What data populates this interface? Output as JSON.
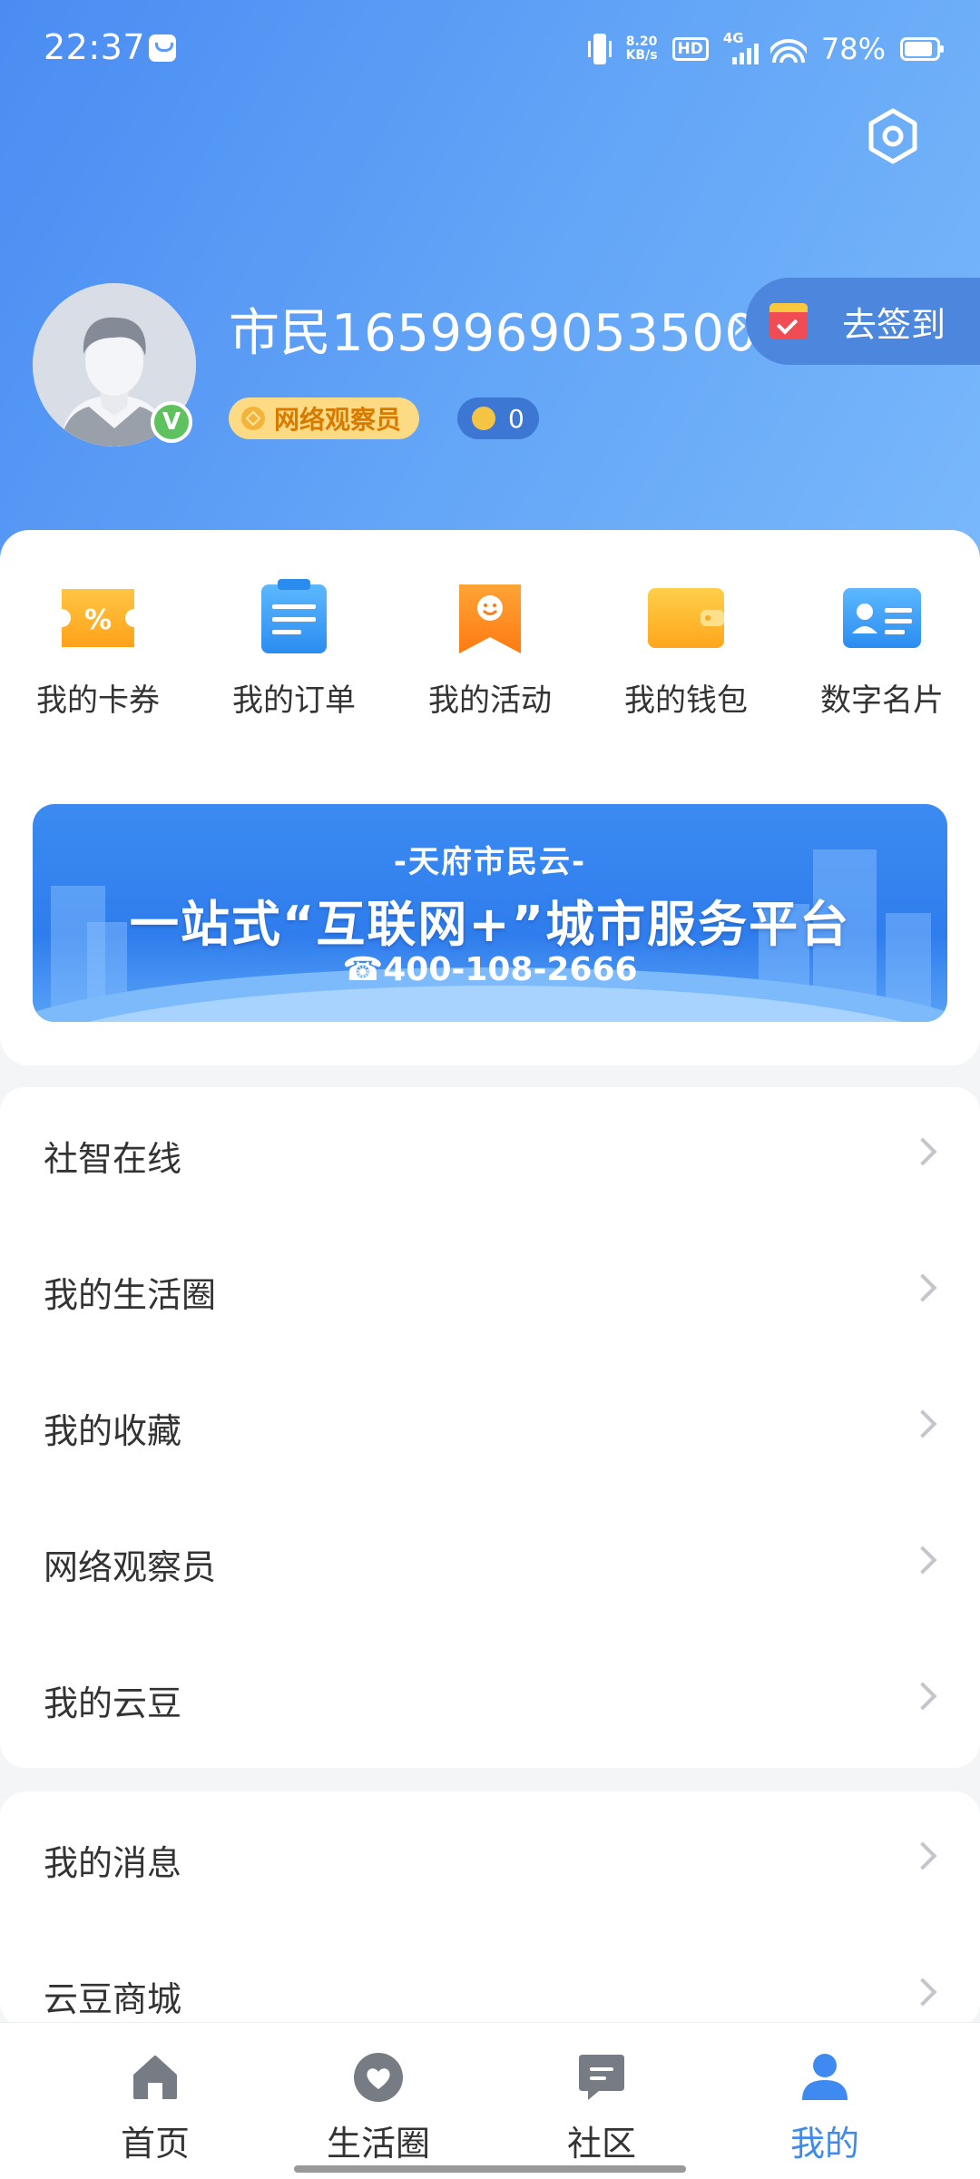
{
  "status_bar": {
    "time": "22:37",
    "net_speed_value": "8.20",
    "net_speed_unit": "KB/s",
    "hd": "HD",
    "network": "4G",
    "battery": "78%"
  },
  "profile": {
    "username": "市民1659969053500",
    "role_badge": "网络观察员",
    "beans_count": "0",
    "verified_mark": "V",
    "signin_label": "去签到"
  },
  "quick_actions": [
    {
      "label": "我的卡券",
      "icon": "coupon-icon",
      "color": "#ffb62d"
    },
    {
      "label": "我的订单",
      "icon": "order-icon",
      "color": "#3a9af2"
    },
    {
      "label": "我的活动",
      "icon": "activity-icon",
      "color": "#ff8a1f"
    },
    {
      "label": "我的钱包",
      "icon": "wallet-icon",
      "color": "#ffb62d"
    },
    {
      "label": "数字名片",
      "icon": "business-card-icon",
      "color": "#3a9af2"
    }
  ],
  "banner": {
    "subtitle": "-天府市民云-",
    "title": "一站式“互联网+”城市服务平台",
    "phone": "☎400-108-2666"
  },
  "menu_group_1": [
    {
      "label": "社智在线"
    },
    {
      "label": "我的生活圈"
    },
    {
      "label": "我的收藏"
    },
    {
      "label": "网络观察员"
    },
    {
      "label": "我的云豆"
    }
  ],
  "menu_group_2": [
    {
      "label": "我的消息"
    },
    {
      "label": "云豆商城"
    }
  ],
  "tabbar": [
    {
      "label": "首页",
      "icon": "home-icon"
    },
    {
      "label": "生活圈",
      "icon": "heart-icon"
    },
    {
      "label": "社区",
      "icon": "chat-icon"
    },
    {
      "label": "我的",
      "icon": "person-icon",
      "active": true
    }
  ],
  "colors": {
    "accent": "#3f8af0",
    "header_gradient_start": "#4a8cf2",
    "header_gradient_end": "#79b8fb",
    "role_badge_bg": "#fddb84",
    "role_badge_text": "#d97a00",
    "verified": "#5ec25f"
  }
}
